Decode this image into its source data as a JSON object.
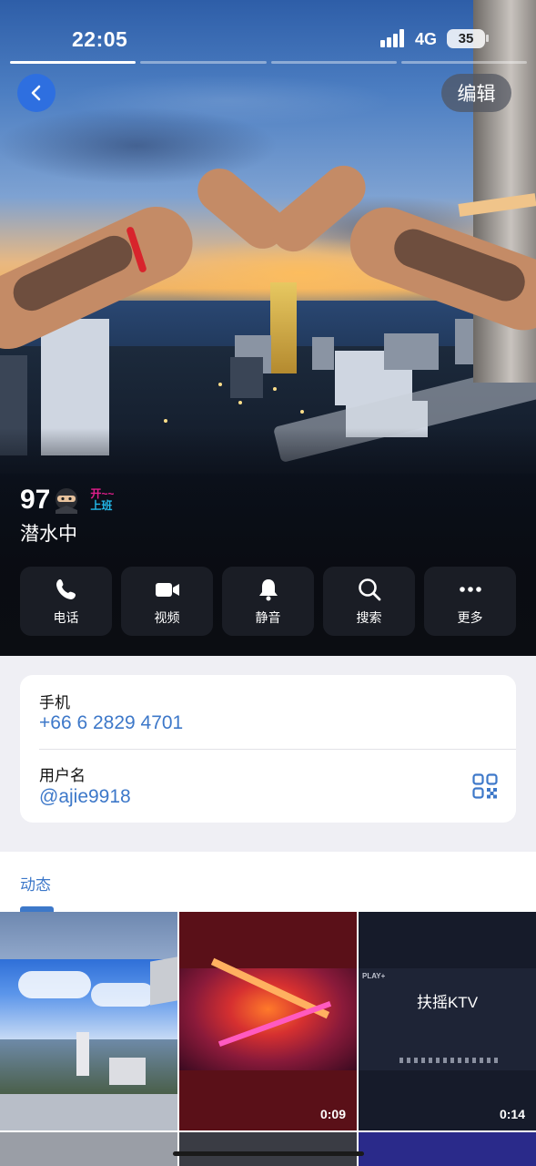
{
  "status_bar": {
    "time": "22:05",
    "network": "4G",
    "battery": "35"
  },
  "story": {
    "segments": 4,
    "active_index": 0
  },
  "header": {
    "edit_label": "编辑"
  },
  "profile": {
    "name": "97",
    "badge_line1": "开~~",
    "badge_line2": "上班",
    "status": "潜水中"
  },
  "actions": [
    {
      "label": "电话",
      "icon": "phone-icon"
    },
    {
      "label": "视频",
      "icon": "video-icon"
    },
    {
      "label": "静音",
      "icon": "bell-icon"
    },
    {
      "label": "搜索",
      "icon": "search-icon"
    },
    {
      "label": "更多",
      "icon": "more-icon"
    }
  ],
  "info": {
    "phone_label": "手机",
    "phone_value": "+66 6 2829 4701",
    "username_label": "用户名",
    "username_value": "@ajie9918"
  },
  "posts": {
    "tab_label": "动态",
    "items": [
      {
        "type": "photo",
        "duration": ""
      },
      {
        "type": "video",
        "duration": "0:09"
      },
      {
        "type": "video",
        "duration": "0:14",
        "caption": "扶摇KTV",
        "tag": "PLAY+"
      }
    ]
  },
  "colors": {
    "accent": "#3d78c9",
    "back_button": "#2e6fe0"
  }
}
